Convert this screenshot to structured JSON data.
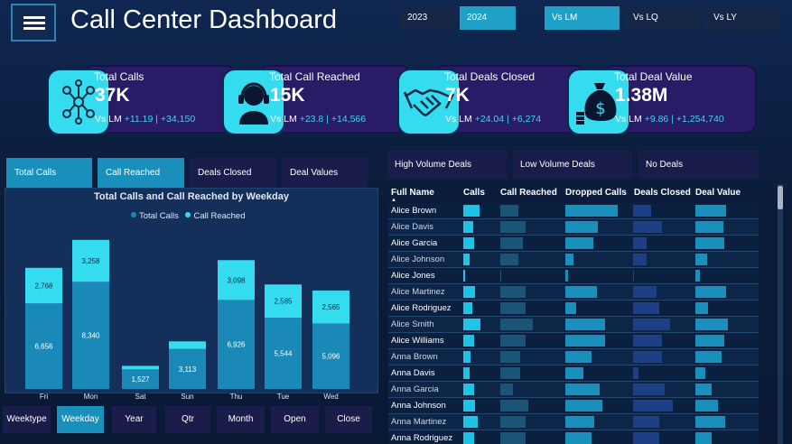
{
  "header": {
    "title": "Call Center Dashboard",
    "years": [
      "2023",
      "2024"
    ],
    "active_year": "2024",
    "comparisons": [
      "Vs LM",
      "Vs LQ",
      "Vs LY"
    ],
    "active_comparison": "Vs LM"
  },
  "kpis": [
    {
      "label": "Total Calls",
      "value": "37K",
      "prefix": "Vs LM",
      "pct": "+11.19",
      "abs": "+34,150",
      "icon": "network-people-icon"
    },
    {
      "label": "Total Call Reached",
      "value": "15K",
      "prefix": "Vs LM",
      "pct": "+23.8",
      "abs": "+14,566",
      "icon": "headset-agent-icon"
    },
    {
      "label": "Total Deals Closed",
      "value": "7K",
      "prefix": "Vs LM",
      "pct": "+24.04",
      "abs": "+6,274",
      "icon": "handshake-icon"
    },
    {
      "label": "Total Deal Value",
      "value": "1.38M",
      "prefix": "Vs LM",
      "pct": "+9.86",
      "abs": "+1,254,740",
      "icon": "money-bag-icon"
    }
  ],
  "chart_tabs": [
    "Total Calls",
    "Call Reached",
    "Deals Closed",
    "Deal Values"
  ],
  "active_chart_tab": "Call Reached",
  "chart_data": {
    "type": "bar",
    "stacked": true,
    "title": "Total Calls and Call Reached by Weekday",
    "categories": [
      "Fri",
      "Mon",
      "Sat",
      "Sun",
      "Thu",
      "Tue",
      "Wed"
    ],
    "series": [
      {
        "name": "Total Calls",
        "values": [
          6656,
          8340,
          1527,
          3113,
          6926,
          5544,
          5096
        ],
        "labels": [
          "6,656",
          "8,340",
          "1,527",
          "3,113",
          "6,926",
          "5,544",
          "5,096"
        ],
        "color": "#1b89b8"
      },
      {
        "name": "Call Reached",
        "values": [
          2768,
          3258,
          268,
          590,
          3098,
          2585,
          2565
        ],
        "labels": [
          "2,768",
          "3,258",
          "",
          "",
          "3,098",
          "2,585",
          "2,565"
        ],
        "color": "#35dcf0"
      }
    ],
    "ylim": [
      0,
      12500
    ],
    "legend": "top-center",
    "grid": false
  },
  "bottom_buttons": [
    "Weektype",
    "Weekday",
    "Year",
    "Qtr",
    "Month",
    "Open",
    "Close"
  ],
  "active_bottom": "Weekday",
  "filters": [
    "High Volume Deals",
    "Low Volume Deals",
    "No Deals"
  ],
  "table": {
    "columns": [
      "Full Name",
      "Calls",
      "Call Reached",
      "Dropped Calls",
      "Deals Closed",
      "Deal Value"
    ],
    "rows": [
      {
        "name": "Alice Brown",
        "calls": 0.75,
        "reached": 0.35,
        "dropped": 1.0,
        "deals": 0.35,
        "value": 0.95
      },
      {
        "name": "Alice Davis",
        "calls": 0.45,
        "reached": 0.5,
        "dropped": 0.62,
        "deals": 0.55,
        "value": 0.85
      },
      {
        "name": "Alice Garcia",
        "calls": 0.5,
        "reached": 0.45,
        "dropped": 0.54,
        "deals": 0.25,
        "value": 0.9
      },
      {
        "name": "Alice Johnson",
        "calls": 0.3,
        "reached": 0.35,
        "dropped": 0.15,
        "deals": 0.25,
        "value": 0.35
      },
      {
        "name": "Alice Jones",
        "calls": 0.1,
        "reached": 0.02,
        "dropped": 0.05,
        "deals": 0.02,
        "value": 0.15
      },
      {
        "name": "Alice Martinez",
        "calls": 0.55,
        "reached": 0.5,
        "dropped": 0.6,
        "deals": 0.45,
        "value": 0.95
      },
      {
        "name": "Alice Rodriguez",
        "calls": 0.4,
        "reached": 0.5,
        "dropped": 0.2,
        "deals": 0.5,
        "value": 0.4
      },
      {
        "name": "Alice Smith",
        "calls": 0.8,
        "reached": 0.65,
        "dropped": 0.75,
        "deals": 0.7,
        "value": 1.0
      },
      {
        "name": "Alice Williams",
        "calls": 0.5,
        "reached": 0.5,
        "dropped": 0.75,
        "deals": 0.55,
        "value": 0.88
      },
      {
        "name": "Anna Brown",
        "calls": 0.35,
        "reached": 0.4,
        "dropped": 0.5,
        "deals": 0.55,
        "value": 0.8
      },
      {
        "name": "Anna Davis",
        "calls": 0.3,
        "reached": 0.4,
        "dropped": 0.35,
        "deals": 0.1,
        "value": 0.3
      },
      {
        "name": "Anna Garcia",
        "calls": 0.5,
        "reached": 0.25,
        "dropped": 0.65,
        "deals": 0.6,
        "value": 0.5
      },
      {
        "name": "Anna Johnson",
        "calls": 0.55,
        "reached": 0.55,
        "dropped": 0.7,
        "deals": 0.75,
        "value": 0.7
      },
      {
        "name": "Anna Martinez",
        "calls": 0.65,
        "reached": 0.5,
        "dropped": 0.55,
        "deals": 0.5,
        "value": 0.92
      },
      {
        "name": "Anna Rodriguez",
        "calls": 0.5,
        "reached": 0.5,
        "dropped": 0.5,
        "deals": 0.5,
        "value": 0.5
      }
    ]
  }
}
